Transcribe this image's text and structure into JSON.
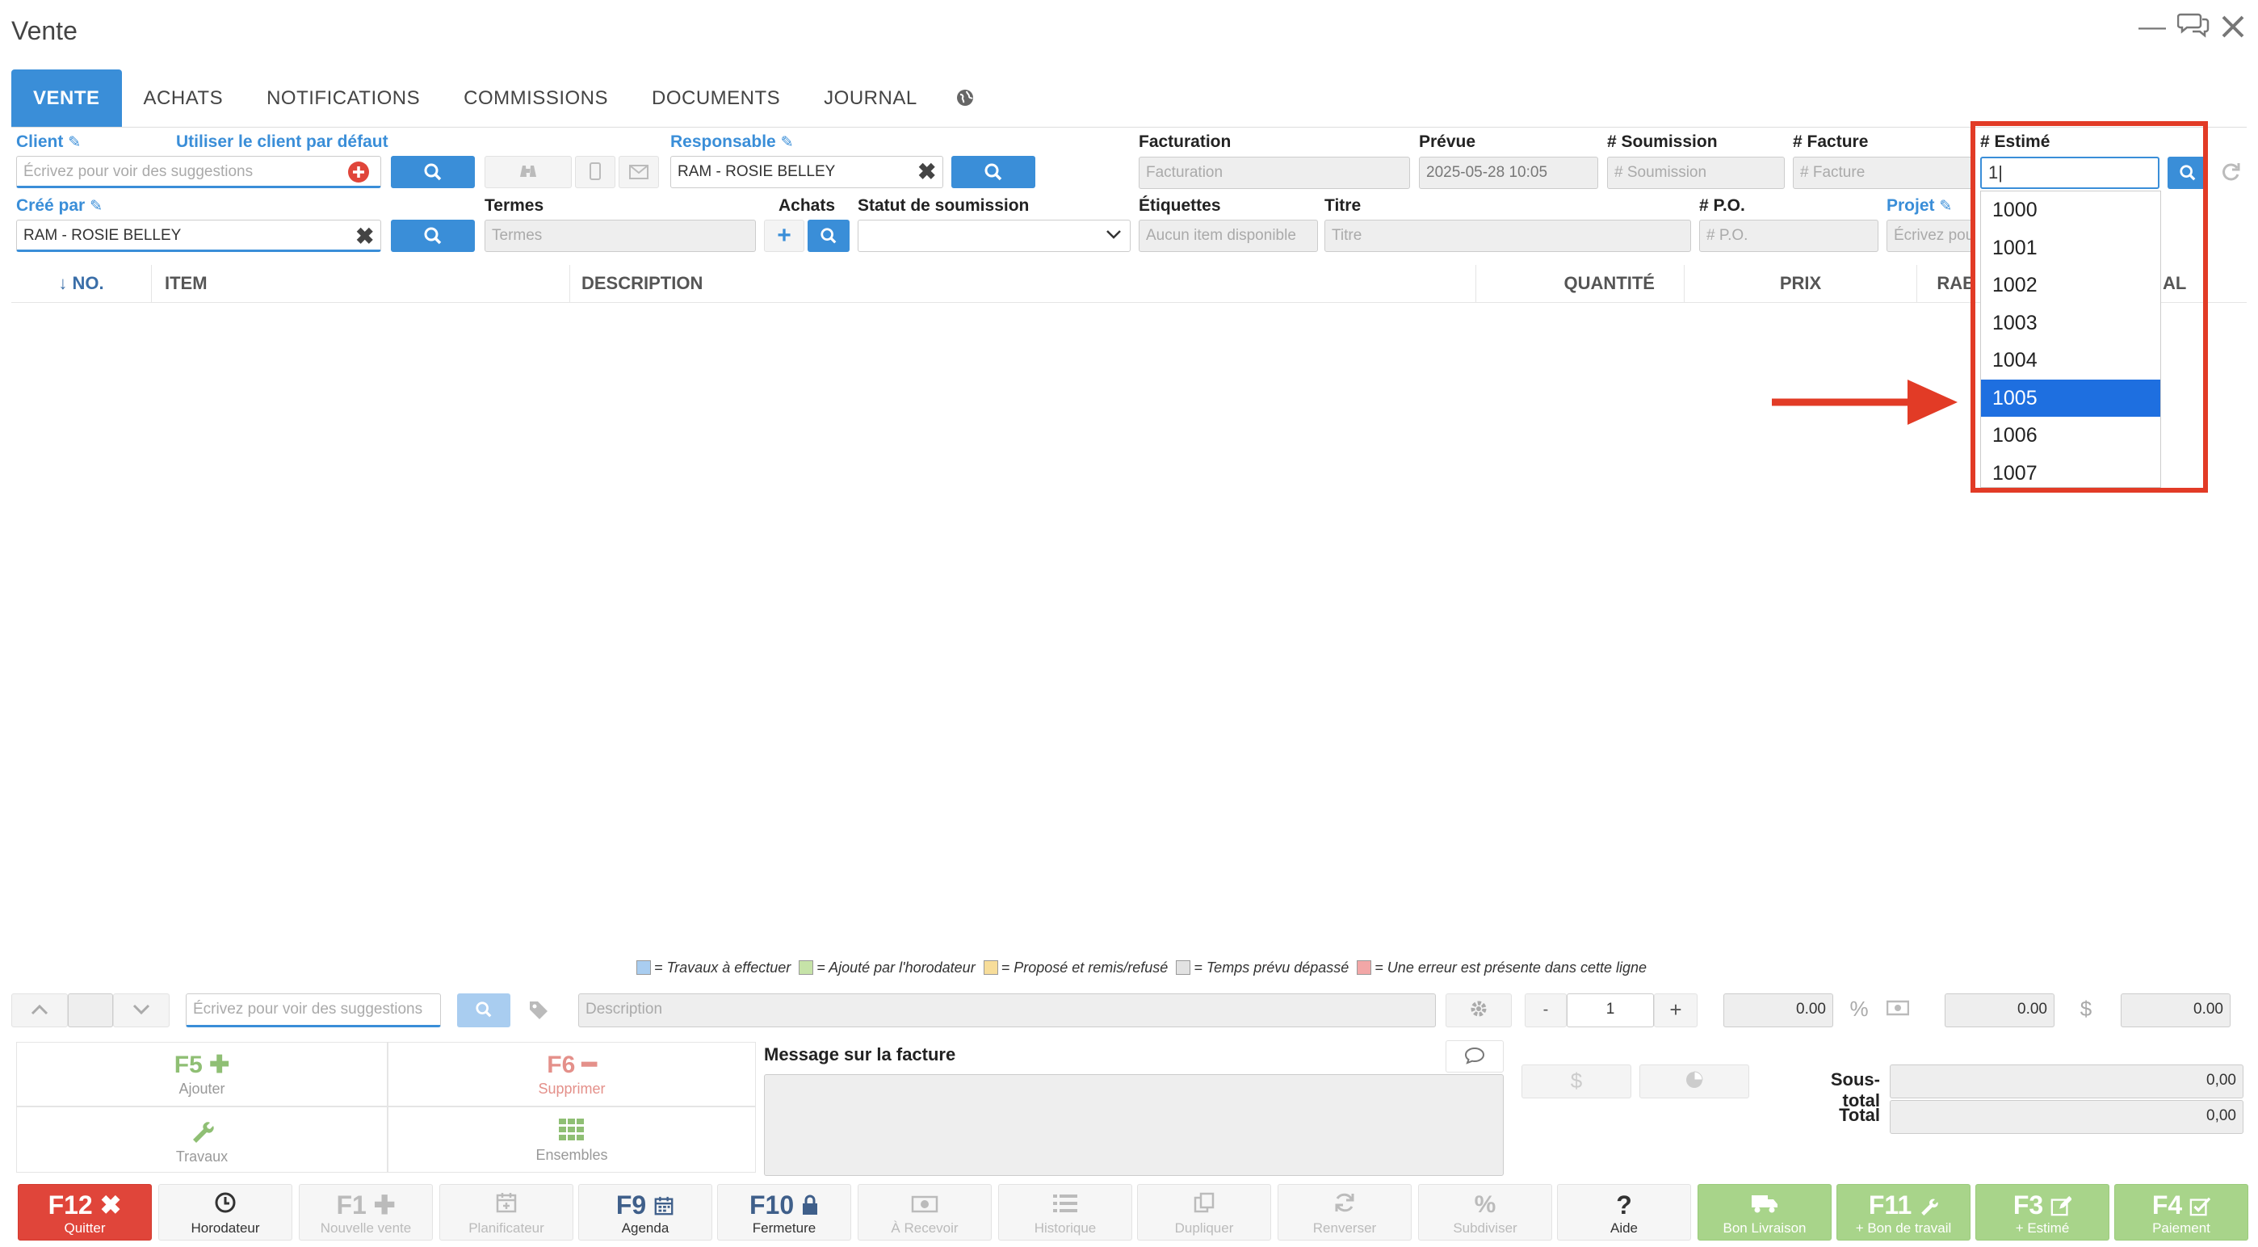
{
  "window": {
    "title": "Vente"
  },
  "tabs": [
    "VENTE",
    "ACHATS",
    "NOTIFICATIONS",
    "COMMISSIONS",
    "DOCUMENTS",
    "JOURNAL"
  ],
  "form": {
    "client_label": "Client",
    "default_client_link": "Utiliser le client par défaut",
    "client_placeholder": "Écrivez pour voir des suggestions",
    "responsable_label": "Responsable",
    "responsable_value": "RAM - ROSIE BELLEY",
    "facturation_label": "Facturation",
    "facturation_placeholder": "Facturation",
    "prevue_label": "Prévue",
    "prevue_value": "2025-05-28 10:05",
    "soumission_label": "# Soumission",
    "soumission_placeholder": "# Soumission",
    "facture_label": "# Facture",
    "facture_placeholder": "# Facture",
    "estime_label": "# Estimé",
    "estime_value": "1",
    "cree_par_label": "Créé par",
    "cree_par_value": "RAM - ROSIE BELLEY",
    "termes_label": "Termes",
    "termes_placeholder": "Termes",
    "achats_label": "Achats",
    "statut_label": "Statut de soumission",
    "etiquettes_label": "Étiquettes",
    "etiquettes_placeholder": "Aucun item disponible",
    "titre_label": "Titre",
    "titre_placeholder": "Titre",
    "po_label": "# P.O.",
    "po_placeholder": "# P.O.",
    "projet_label": "Projet",
    "projet_placeholder": "Écrivez pou"
  },
  "table": {
    "columns": [
      "↓ NO.",
      "ITEM",
      "DESCRIPTION",
      "QUANTITÉ",
      "PRIX",
      "RAB",
      "AL"
    ]
  },
  "estime_dropdown": {
    "items": [
      "1000",
      "1001",
      "1002",
      "1003",
      "1004",
      "1005",
      "1006",
      "1007"
    ],
    "selected": "1005"
  },
  "legend": [
    {
      "color": "#a9cdf0",
      "text": "= Travaux à effectuer"
    },
    {
      "color": "#c6e3a8",
      "text": "= Ajouté par l'horodateur"
    },
    {
      "color": "#f7dd9a",
      "text": "= Proposé et remis/refusé"
    },
    {
      "color": "#e2e2e2",
      "text": "= Temps prévu dépassé"
    },
    {
      "color": "#f2a7a7",
      "text": "= Une erreur est présente dans cette ligne"
    }
  ],
  "line_entry": {
    "item_placeholder": "Écrivez pour voir des suggestions",
    "description_placeholder": "Description",
    "quantity": "1",
    "minus": "-",
    "plus": "+",
    "price": "0.00",
    "discount": "0.00",
    "total": "0.00",
    "percent": "%",
    "dollar": "$"
  },
  "actions": {
    "f5_key": "F5",
    "f5_label": "Ajouter",
    "f6_key": "F6",
    "f6_label": "Supprimer",
    "travaux_label": "Travaux",
    "ensembles_label": "Ensembles"
  },
  "message": {
    "label": "Message sur la facture"
  },
  "totals": {
    "dollar": "$",
    "sous_total_label": "Sous-total",
    "sous_total_value": "0,00",
    "total_label": "Total",
    "total_value": "0,00"
  },
  "bottom_bar": [
    {
      "key": "F12",
      "label": "Quitter"
    },
    {
      "key": "",
      "label": "Horodateur"
    },
    {
      "key": "F1",
      "label": "Nouvelle vente"
    },
    {
      "key": "",
      "label": "Planificateur"
    },
    {
      "key": "F9",
      "label": "Agenda"
    },
    {
      "key": "F10",
      "label": "Fermeture"
    },
    {
      "key": "",
      "label": "À Recevoir"
    },
    {
      "key": "",
      "label": "Historique"
    },
    {
      "key": "",
      "label": "Dupliquer"
    },
    {
      "key": "",
      "label": "Renverser"
    },
    {
      "key": "",
      "label": "Subdiviser"
    },
    {
      "key": "?",
      "label": "Aide"
    },
    {
      "key": "",
      "label": "Bon Livraison"
    },
    {
      "key": "F11",
      "label": "+ Bon de travail"
    },
    {
      "key": "F3",
      "label": "+ Estimé"
    },
    {
      "key": "F4",
      "label": "Paiement"
    }
  ],
  "colors": {
    "accent": "#3a8ed8",
    "highlight_red": "#e23b26",
    "selected_blue": "#1e6fe0",
    "green": "#a8d48a",
    "quit_red": "#e0453a"
  }
}
